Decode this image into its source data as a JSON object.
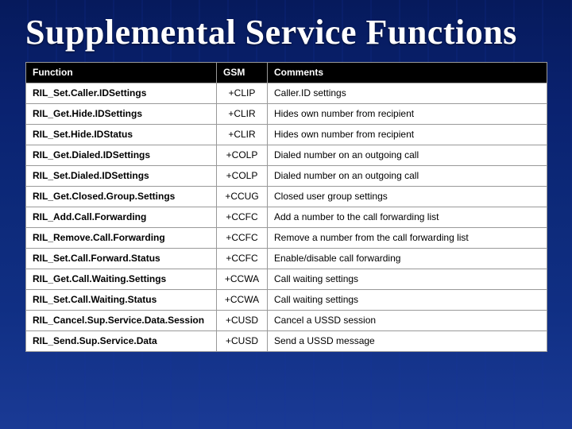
{
  "title": "Supplemental Service Functions",
  "headers": {
    "c1": "Function",
    "c2": "GSM",
    "c3": "Comments"
  },
  "rows": [
    {
      "fn": "RIL_Set.Caller.IDSettings",
      "gsm": "+CLIP",
      "comment": "Caller.ID settings"
    },
    {
      "fn": "RIL_Get.Hide.IDSettings",
      "gsm": "+CLIR",
      "comment": "Hides own number from recipient"
    },
    {
      "fn": "RIL_Set.Hide.IDStatus",
      "gsm": "+CLIR",
      "comment": "Hides own number from recipient"
    },
    {
      "fn": "RIL_Get.Dialed.IDSettings",
      "gsm": "+COLP",
      "comment": "Dialed number on an outgoing call"
    },
    {
      "fn": "RIL_Set.Dialed.IDSettings",
      "gsm": "+COLP",
      "comment": "Dialed number on an outgoing call"
    },
    {
      "fn": "RIL_Get.Closed.Group.Settings",
      "gsm": "+CCUG",
      "comment": "Closed user group settings"
    },
    {
      "fn": "RIL_Add.Call.Forwarding",
      "gsm": "+CCFC",
      "comment": "Add a number to the call forwarding list"
    },
    {
      "fn": "RIL_Remove.Call.Forwarding",
      "gsm": "+CCFC",
      "comment": "Remove a number from the call forwarding list"
    },
    {
      "fn": "RIL_Set.Call.Forward.Status",
      "gsm": "+CCFC",
      "comment": "Enable/disable call forwarding"
    },
    {
      "fn": "RIL_Get.Call.Waiting.Settings",
      "gsm": "+CCWA",
      "comment": "Call waiting settings"
    },
    {
      "fn": "RIL_Set.Call.Waiting.Status",
      "gsm": "+CCWA",
      "comment": "Call waiting settings"
    },
    {
      "fn": "RIL_Cancel.Sup.Service.Data.Session",
      "gsm": "+CUSD",
      "comment": "Cancel a USSD session"
    },
    {
      "fn": "RIL_Send.Sup.Service.Data",
      "gsm": "+CUSD",
      "comment": "Send a USSD message"
    }
  ]
}
